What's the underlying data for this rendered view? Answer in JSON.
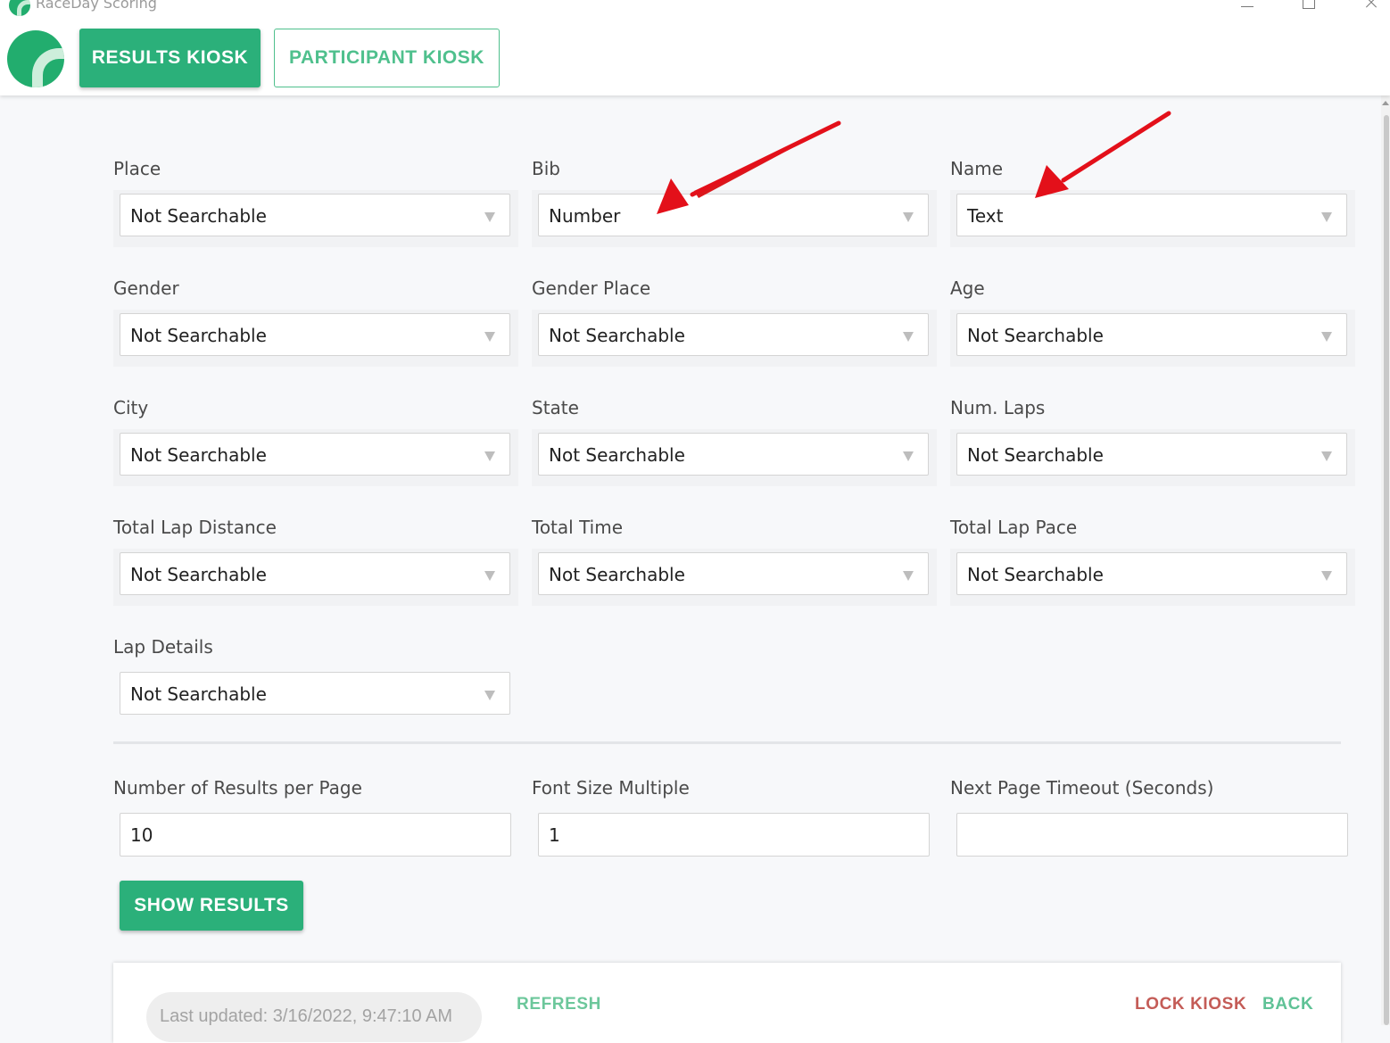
{
  "window": {
    "title": "RaceDay Scoring"
  },
  "tabs": {
    "results": "RESULTS KIOSK",
    "participant": "PARTICIPANT KIOSK"
  },
  "fields": [
    {
      "label": "Place",
      "value": "Not Searchable"
    },
    {
      "label": "Bib",
      "value": "Number"
    },
    {
      "label": "Name",
      "value": "Text"
    },
    {
      "label": "Gender",
      "value": "Not Searchable"
    },
    {
      "label": "Gender Place",
      "value": "Not Searchable"
    },
    {
      "label": "Age",
      "value": "Not Searchable"
    },
    {
      "label": "City",
      "value": "Not Searchable"
    },
    {
      "label": "State",
      "value": "Not Searchable"
    },
    {
      "label": "Num. Laps",
      "value": "Not Searchable"
    },
    {
      "label": "Total Lap Distance",
      "value": "Not Searchable"
    },
    {
      "label": "Total Time",
      "value": "Not Searchable"
    },
    {
      "label": "Total Lap Pace",
      "value": "Not Searchable"
    },
    {
      "label": "Lap Details",
      "value": "Not Searchable"
    }
  ],
  "settings": {
    "results_per_page": {
      "label": "Number of Results per Page",
      "value": "10"
    },
    "font_size_multiple": {
      "label": "Font Size Multiple",
      "value": "1"
    },
    "next_page_timeout": {
      "label": "Next Page Timeout (Seconds)",
      "value": ""
    }
  },
  "show_results_label": "SHOW RESULTS",
  "footer": {
    "last_updated": "Last updated: 3/16/2022, 9:47:10 AM",
    "refresh": "REFRESH",
    "lock_kiosk": "LOCK KIOSK",
    "back": "BACK"
  },
  "colors": {
    "brand_green": "#2bb07a",
    "danger_red": "#c45c57",
    "annotation_red": "#e3101a"
  }
}
